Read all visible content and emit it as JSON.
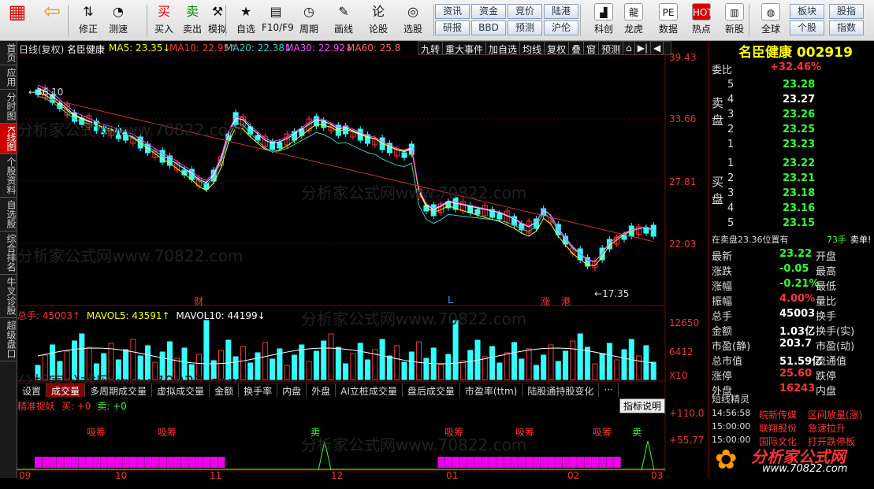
{
  "toolbar": {
    "left": [
      {
        "label": "",
        "icon": "app-grid-icon"
      },
      {
        "label": "",
        "icon": "back-arrow-icon"
      },
      {
        "label": "修正",
        "icon": "up-down-icon"
      },
      {
        "label": "测速",
        "icon": "timer-icon"
      },
      {
        "label": "买入",
        "icon": "buy-icon"
      },
      {
        "label": "卖出",
        "icon": "sell-icon"
      },
      {
        "label": "模拟",
        "icon": "hammer-icon"
      },
      {
        "label": "自选",
        "icon": "star-icon"
      },
      {
        "label": "F10/F9",
        "icon": "f10-icon"
      },
      {
        "label": "周期",
        "icon": "clock-icon"
      },
      {
        "label": "画线",
        "icon": "pencil-icon"
      },
      {
        "label": "论股",
        "icon": "chat-icon"
      },
      {
        "label": "选股",
        "icon": "scan-icon"
      }
    ],
    "buttons": [
      [
        "资讯",
        "资金",
        "竞价",
        "陆港"
      ],
      [
        "研报",
        "BBD",
        "预测",
        "沪伦"
      ]
    ],
    "right": [
      {
        "label": "科创",
        "icon": "chart-icon"
      },
      {
        "label": "龙虎",
        "icon": "dragon-icon"
      },
      {
        "label": "数据",
        "icon": "pe-icon"
      },
      {
        "label": "热点",
        "icon": "hot-icon"
      },
      {
        "label": "新股",
        "icon": "ipo-icon"
      },
      {
        "label": "全球",
        "icon": "globe-icon"
      }
    ],
    "buttons2": [
      [
        "板块",
        "股指"
      ],
      [
        "个股",
        "指数"
      ]
    ]
  },
  "sidebar": [
    {
      "label": "首页"
    },
    {
      "label": "应用"
    },
    {
      "label": "分时图"
    },
    {
      "label": "K线图",
      "active": true
    },
    {
      "label": "个股资料"
    },
    {
      "label": "自选股"
    },
    {
      "label": "综合排名"
    },
    {
      "label": "牛叉诊股"
    },
    {
      "label": "超级盘口"
    }
  ],
  "kline_header": {
    "mode": "日线(复权)",
    "name": "名臣健康",
    "ma5": "MA5: 23.35↓",
    "ma10": "MA10: 22.95↑",
    "ma20": "MA20: 22.38↓",
    "ma30": "MA30: 22.92↓",
    "ma60": "MA60: 25.8"
  },
  "right_tools": [
    "九转",
    "重大事件",
    "加自选",
    "均线",
    "复权",
    "叠",
    "窗",
    "预测",
    "⌂",
    "▶|",
    "◀"
  ],
  "price_axis": [
    "39.43",
    "33.66",
    "27.81",
    "22.03"
  ],
  "price_high_label": "36.10",
  "price_low_label": "17.35",
  "event_labels": [
    "财",
    "L",
    "涨",
    "港"
  ],
  "volume_header": {
    "vol": "总手: 45003↑",
    "mavol5": "MAVOL5: 43591↑",
    "mavol10": "MAVOL10: 44199↓"
  },
  "volume_axis": [
    "12650",
    "6412",
    "X10"
  ],
  "indicator_tabs": [
    "设置",
    "成交量",
    "多周期成交量",
    "虚拟成交量",
    "金额",
    "换手率",
    "内盘",
    "外盘",
    "AI立桩成交量",
    "盘后成交量",
    "市盈率(ttm)",
    "陆股通持股变化",
    "···"
  ],
  "indicator": {
    "title": "精准捉妖",
    "buy": "买: +0",
    "sell": "卖: +0",
    "button": "指标说明",
    "axis": [
      "+110.0",
      "+55.77"
    ],
    "signals": [
      "吸筹",
      "吸筹",
      "卖",
      "吸筹",
      "吸筹",
      "吸筹",
      "卖"
    ]
  },
  "months": [
    "09",
    "10",
    "11",
    "12",
    "01",
    "02",
    "03"
  ],
  "watermark": "分析家公式网www.70822.com",
  "quote": {
    "name": "名臣健康",
    "code": "002919",
    "weibi_label": "委比",
    "weibi": "+32.46%",
    "sell": [
      [
        "5",
        "23.28"
      ],
      [
        "4",
        "23.27"
      ],
      [
        "3",
        "23.26"
      ],
      [
        "2",
        "23.25"
      ],
      [
        "1",
        "23.23"
      ]
    ],
    "buy": [
      [
        "1",
        "23.22"
      ],
      [
        "2",
        "23.21"
      ],
      [
        "3",
        "23.18"
      ],
      [
        "4",
        "23.16"
      ],
      [
        "5",
        "23.15"
      ]
    ],
    "sell_label": "卖盘",
    "buy_label": "买盘",
    "status": "在卖盘23.36位置有",
    "status_num": "73手",
    "status_act": "卖单!",
    "stats": [
      [
        "最新",
        "23.22",
        "开盘",
        ""
      ],
      [
        "涨跌",
        "-0.05",
        "最高",
        ""
      ],
      [
        "涨幅",
        "-0.21%",
        "最低",
        ""
      ],
      [
        "振幅",
        "4.00%",
        "量比",
        ""
      ],
      [
        "总手",
        "45003",
        "换手",
        ""
      ],
      [
        "金额",
        "1.03亿",
        "换手(实)",
        ""
      ],
      [
        "市盈(静)",
        "203.7",
        "市盈(动)",
        ""
      ],
      [
        "总市值",
        "51.59亿",
        "流通值",
        ""
      ],
      [
        "涨停",
        "25.60",
        "跌停",
        ""
      ],
      [
        "外盘",
        "16243",
        "内盘",
        ""
      ]
    ],
    "short_title": "短线精灵",
    "short": [
      [
        "14:56:58",
        "皖新传媒",
        "区间放量(涨)"
      ],
      [
        "15:00:00",
        "联翔股份",
        "急速拉升"
      ],
      [
        "15:00:00",
        "国际文化",
        "打开跌停板"
      ]
    ]
  },
  "logo": "分析家公式网",
  "logo_url": "www.70822.com",
  "colors": {
    "up": "#ff3333",
    "down": "#33ffff",
    "ma5": "#ffffff",
    "ma10": "#ffff00",
    "ma20": "#00ff00",
    "ma30": "#ff44ff",
    "ma60": "#ff6666"
  }
}
